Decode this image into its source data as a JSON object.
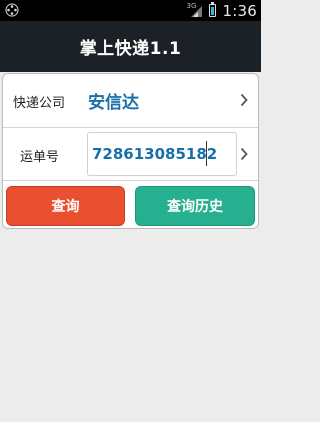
{
  "status_bar": {
    "network": "3G",
    "time": "1:36"
  },
  "title_bar": {
    "title": "掌上快递1.1"
  },
  "form": {
    "company": {
      "label": "快递公司",
      "value": "安信达"
    },
    "tracking": {
      "label": "运单号",
      "value": "728613085182"
    }
  },
  "buttons": {
    "query": "查询",
    "history": "查询历史"
  },
  "colors": {
    "title_bar": "#1c2027",
    "query_button": "#e8502f",
    "history_button": "#27b08f",
    "value_text": "#1a6fa8"
  }
}
